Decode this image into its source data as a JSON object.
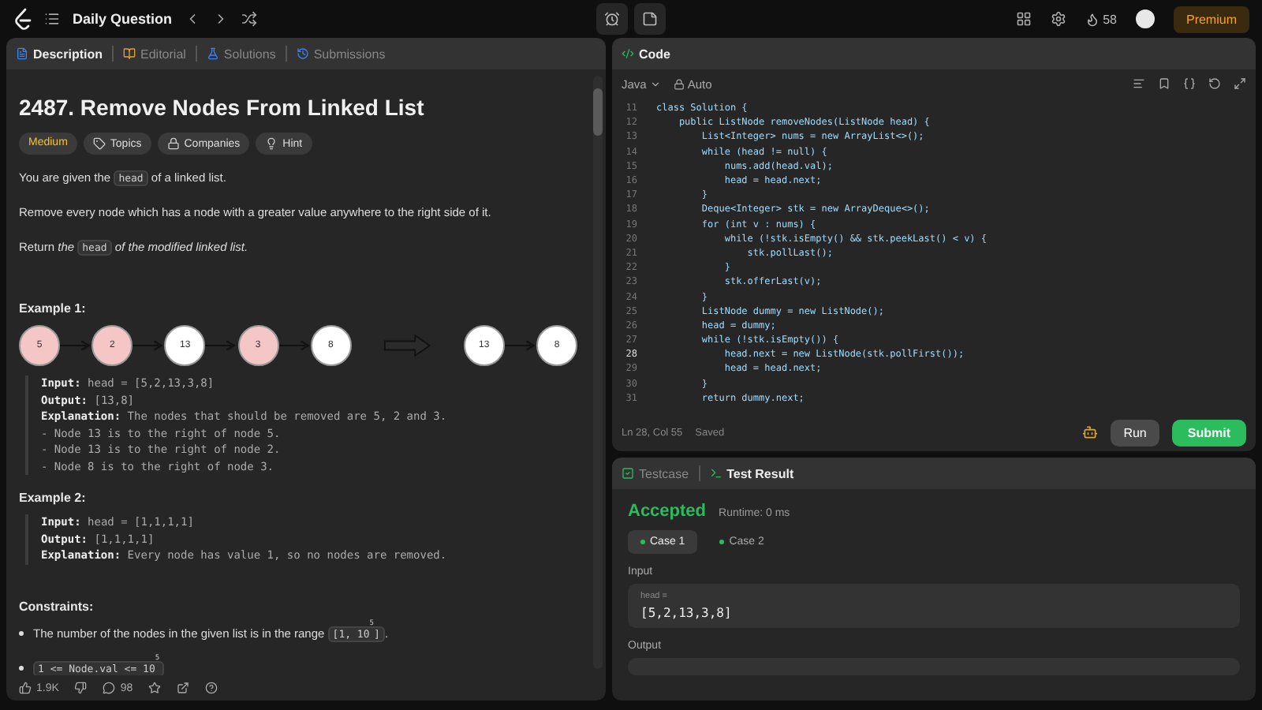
{
  "topbar": {
    "title": "Daily Question",
    "streak": "58",
    "premium": "Premium"
  },
  "left_tabs": [
    {
      "label": "Description",
      "selected": true
    },
    {
      "label": "Editorial",
      "selected": false
    },
    {
      "label": "Solutions",
      "selected": false
    },
    {
      "label": "Submissions",
      "selected": false
    }
  ],
  "problem": {
    "title": "2487. Remove Nodes From Linked List",
    "difficulty": "Medium",
    "tags": [
      {
        "label": "Topics"
      },
      {
        "label": "Companies"
      },
      {
        "label": "Hint"
      }
    ],
    "paragraphs": [
      [
        {
          "text": "You are given the ",
          "kind": "text"
        },
        {
          "text": "head",
          "kind": "code"
        },
        {
          "text": " of a linked list.",
          "kind": "text"
        }
      ],
      [
        {
          "text": "Remove every node which has a node with a greater value anywhere to the right side of it.",
          "kind": "text"
        }
      ],
      [
        {
          "text": "Return *the* ",
          "kind": "text"
        },
        {
          "text": "head",
          "kind": "code"
        },
        {
          "text": " *of the modified linked list.*",
          "kind": "text"
        }
      ]
    ],
    "examples": [
      {
        "title": "Example 1:",
        "diagram": {
          "nodes": [
            {
              "label": "5",
              "removed": true
            },
            {
              "label": "2",
              "removed": true
            },
            {
              "label": "13",
              "removed": false
            },
            {
              "label": "3",
              "removed": true
            },
            {
              "label": "8",
              "removed": false
            }
          ],
          "result": [
            {
              "label": "13",
              "removed": false
            },
            {
              "label": "8",
              "removed": false
            }
          ]
        },
        "lines": [
          "**Input:** head = [5,2,13,3,8]",
          "**Output:** [13,8]",
          "**Explanation:** The nodes that should be removed are 5, 2 and 3.",
          "- Node 13 is to the right of node 5.",
          "- Node 13 is to the right of node 2.",
          "- Node 8 is to the right of node 3."
        ]
      },
      {
        "title": "Example 2:",
        "lines": [
          "**Input:** head = [1,1,1,1]",
          "**Output:** [1,1,1,1]",
          "**Explanation:** Every node has value 1, so no nodes are removed."
        ]
      }
    ],
    "constraints_title": "Constraints:",
    "constraints": [
      [
        {
          "text": "The number of the nodes in the given list is in the range ",
          "kind": "text"
        },
        {
          "text": "[1, 10$^{5}$]",
          "kind": "code"
        },
        {
          "text": ".",
          "kind": "text"
        }
      ],
      [
        {
          "text": "1 <= Node.val <= 10$^{5}$",
          "kind": "code"
        }
      ]
    ],
    "likes": "1.9K",
    "comments": "98"
  },
  "code_panel": {
    "title": "Code",
    "language": "Java",
    "mode": "Auto",
    "lines": [
      {
        "n": "11",
        "text": "class Solution {",
        "current": false
      },
      {
        "n": "12",
        "text": "    public ListNode removeNodes(ListNode head) {",
        "current": false
      },
      {
        "n": "13",
        "text": "        List<Integer> nums = new ArrayList<>();",
        "current": false
      },
      {
        "n": "14",
        "text": "        while (head != null) {",
        "current": false
      },
      {
        "n": "15",
        "text": "            nums.add(head.val);",
        "current": false
      },
      {
        "n": "16",
        "text": "            head = head.next;",
        "current": false
      },
      {
        "n": "17",
        "text": "        }",
        "current": false
      },
      {
        "n": "18",
        "text": "        Deque<Integer> stk = new ArrayDeque<>();",
        "current": false
      },
      {
        "n": "19",
        "text": "        for (int v : nums) {",
        "current": false
      },
      {
        "n": "20",
        "text": "            while (!stk.isEmpty() && stk.peekLast() < v) {",
        "current": false
      },
      {
        "n": "21",
        "text": "                stk.pollLast();",
        "current": false
      },
      {
        "n": "22",
        "text": "            }",
        "current": false
      },
      {
        "n": "23",
        "text": "            stk.offerLast(v);",
        "current": false
      },
      {
        "n": "24",
        "text": "        }",
        "current": false
      },
      {
        "n": "25",
        "text": "        ListNode dummy = new ListNode();",
        "current": false
      },
      {
        "n": "26",
        "text": "        head = dummy;",
        "current": false
      },
      {
        "n": "27",
        "text": "        while (!stk.isEmpty()) {",
        "current": false
      },
      {
        "n": "28",
        "text": "            head.next = new ListNode(stk.pollFirst());",
        "current": true
      },
      {
        "n": "29",
        "text": "            head = head.next;",
        "current": false
      },
      {
        "n": "30",
        "text": "        }",
        "current": false
      },
      {
        "n": "31",
        "text": "        return dummy.next;",
        "current": false
      }
    ],
    "position": "Ln 28, Col 55",
    "save_state": "Saved",
    "run": "Run",
    "submit": "Submit"
  },
  "test_tabs": [
    {
      "label": "Testcase",
      "selected": false
    },
    {
      "label": "Test Result",
      "selected": true
    }
  ],
  "result": {
    "status": "Accepted",
    "runtime": "Runtime: 0 ms",
    "cases": [
      {
        "label": "Case 1",
        "selected": true
      },
      {
        "label": "Case 2",
        "selected": false
      }
    ],
    "input_label": "Input",
    "input_name": "head =",
    "input_value": "[5,2,13,3,8]",
    "output_label": "Output"
  }
}
